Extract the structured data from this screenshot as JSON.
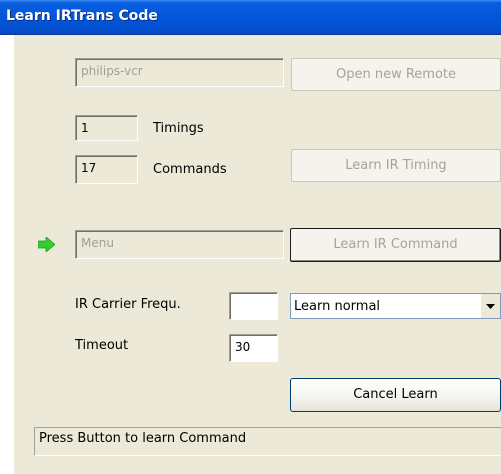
{
  "window": {
    "title": "Learn IRTrans Code"
  },
  "remote": {
    "name_value": "philips-vcr",
    "open_new_remote_label": "Open new Remote"
  },
  "timings": {
    "count": "1",
    "label": "Timings"
  },
  "commands": {
    "count": "17",
    "label": "Commands"
  },
  "learn_ir_timing_label": "Learn IR Timing",
  "command_name_value": "Menu",
  "learn_ir_command_label": "Learn IR Command",
  "carrier": {
    "label": "IR Carrier Frequ.",
    "value": ""
  },
  "learn_mode": {
    "selected": "Learn normal"
  },
  "timeout": {
    "label": "Timeout",
    "value": "30"
  },
  "cancel_learn_label": "Cancel Learn",
  "status": {
    "text": "Press Button to learn Command"
  },
  "colors": {
    "accent_arrow": "#32cd32",
    "title_bar": "#0456d8",
    "dialog_bg": "#ece9d8"
  },
  "icons": [
    "green-arrow-icon",
    "chevron-down-icon"
  ]
}
